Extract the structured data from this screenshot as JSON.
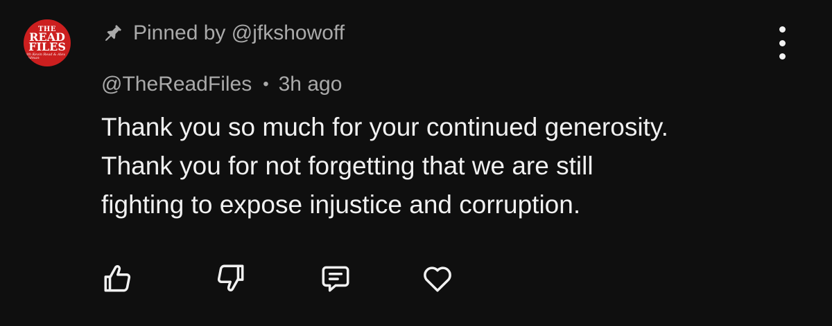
{
  "comment": {
    "avatar": {
      "line1": "THE",
      "line2": "READ",
      "line3": "FILES",
      "tagline": "with Kevin Read & Alex Goldman"
    },
    "pinned_label": "Pinned by @jfkshowoff",
    "author": "@TheReadFiles",
    "separator": "•",
    "timestamp": "3h ago",
    "text_lines": [
      "Thank you so much for your continued generosity.",
      "Thank you for not forgetting that we are still",
      "fighting to expose injustice and corruption."
    ]
  },
  "icons": {
    "pin": "pin-icon",
    "more": "more-vertical-icon",
    "like": "thumbs-up-icon",
    "dislike": "thumbs-down-icon",
    "reply": "comment-icon",
    "heart": "heart-icon"
  },
  "colors": {
    "background": "#0f0f0f",
    "text_primary": "#f1f1f1",
    "text_secondary": "#aaaaaa",
    "avatar_red": "#cc1f1f"
  }
}
